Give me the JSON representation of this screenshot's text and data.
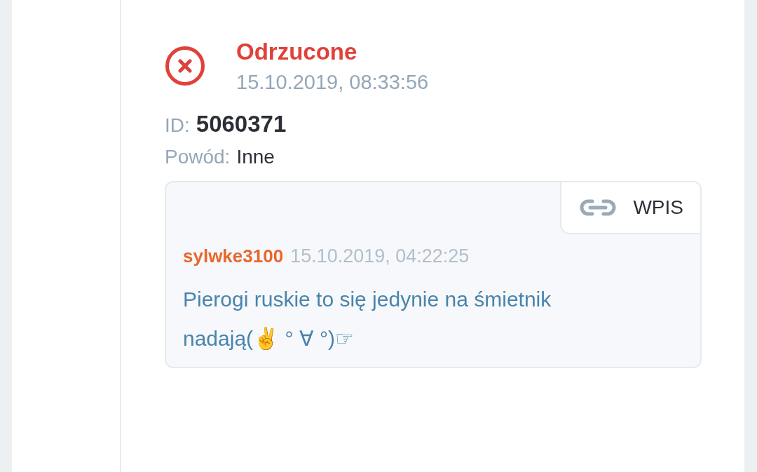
{
  "status": {
    "kind": "rejected",
    "label": "Odrzucone",
    "date": "15.10.2019, 08:33:56"
  },
  "details": [
    {
      "label": "ID:",
      "value": "5060371",
      "emphasis": true
    },
    {
      "label": "Powód:",
      "value": "Inne",
      "emphasis": false
    }
  ],
  "entry": {
    "link_label": "WPIS",
    "author": "sylwke3100",
    "date": "15.10.2019, 04:22:25",
    "text": "Pierogi ruskie to się jedynie na śmietnik nadają(✌ ° ∀ °)☞"
  }
}
